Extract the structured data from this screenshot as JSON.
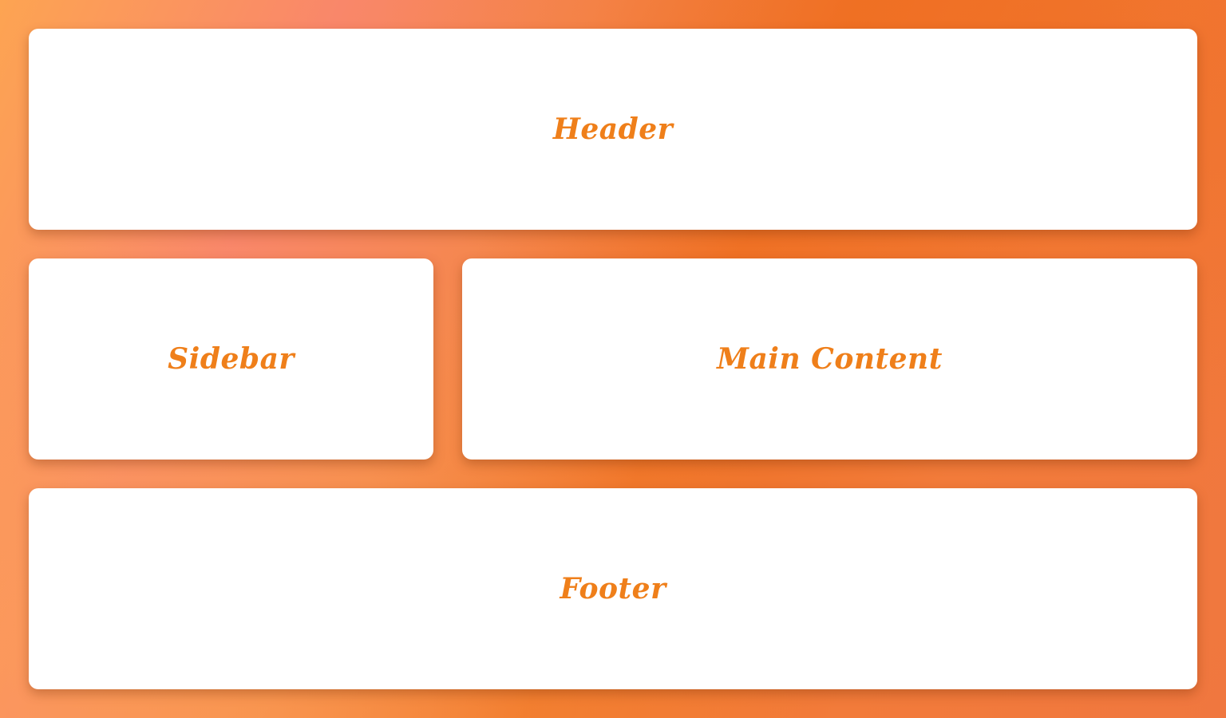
{
  "layout": {
    "header": {
      "label": "Header"
    },
    "sidebar": {
      "label": "Sidebar"
    },
    "main": {
      "label": "Main Content"
    },
    "footer": {
      "label": "Footer"
    }
  },
  "colors": {
    "accent_text": "#ef7f1a",
    "card_background": "#ffffff",
    "background_gradient": [
      "#fda452",
      "#f9876a",
      "#ef7226",
      "#f0773f"
    ]
  }
}
